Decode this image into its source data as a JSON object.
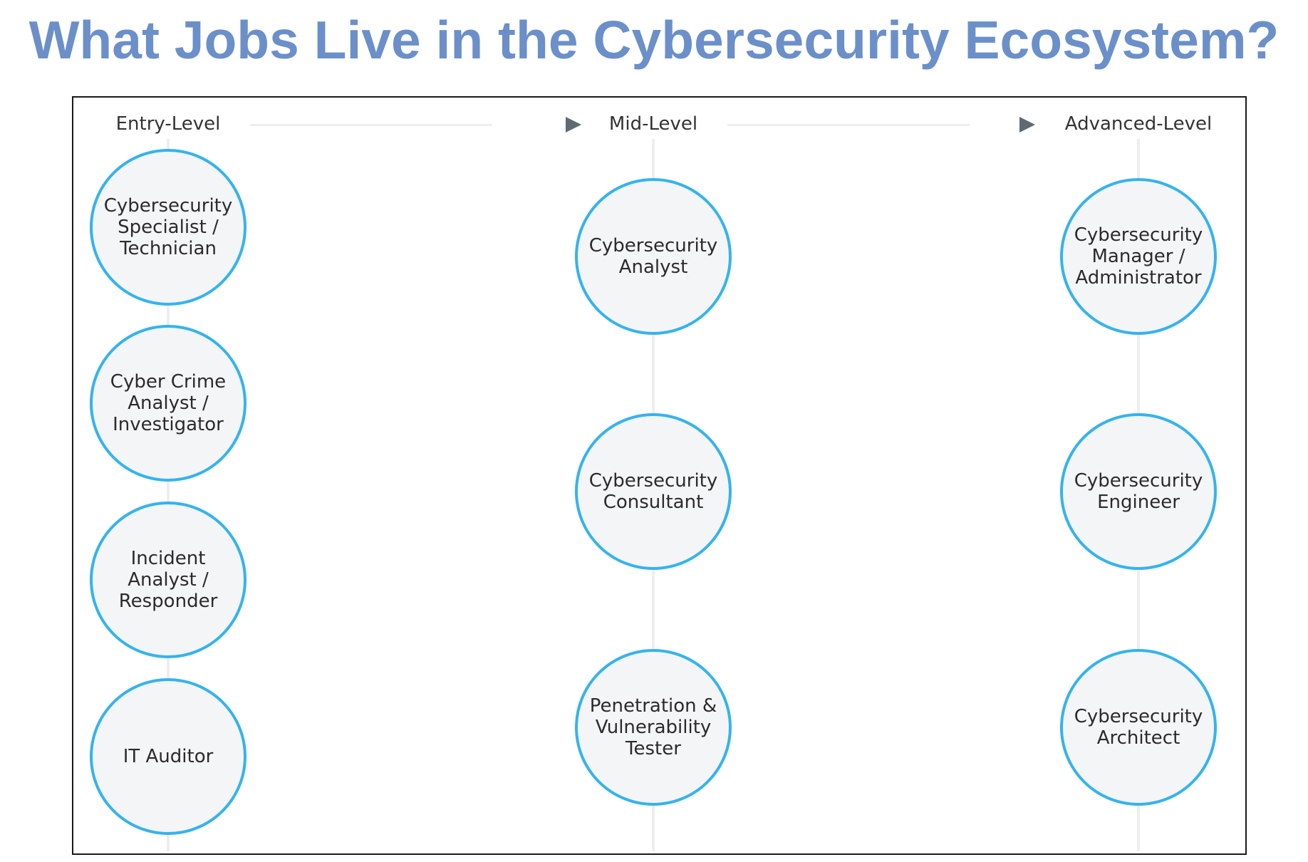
{
  "title": "What Jobs Live in the Cybersecurity Ecosystem?",
  "colors": {
    "title": "#6b8fc9",
    "node_border": "#35b3ec",
    "node_fill": "#f4f5f6",
    "arrow": "#5f6b73",
    "connector": "#eeeeee"
  },
  "levels": [
    {
      "heading": "Entry-Level",
      "jobs": [
        "Cybersecurity\nSpecialist /\nTechnician",
        "Cyber Crime\nAnalyst /\nInvestigator",
        "Incident\nAnalyst /\nResponder",
        "IT Auditor"
      ]
    },
    {
      "heading": "Mid-Level",
      "jobs": [
        "Cybersecurity\nAnalyst",
        "Cybersecurity\nConsultant",
        "Penetration &\nVulnerability\nTester"
      ]
    },
    {
      "heading": "Advanced-Level",
      "jobs": [
        "Cybersecurity\nManager /\nAdministrator",
        "Cybersecurity\nEngineer",
        "Cybersecurity\nArchitect"
      ]
    }
  ]
}
